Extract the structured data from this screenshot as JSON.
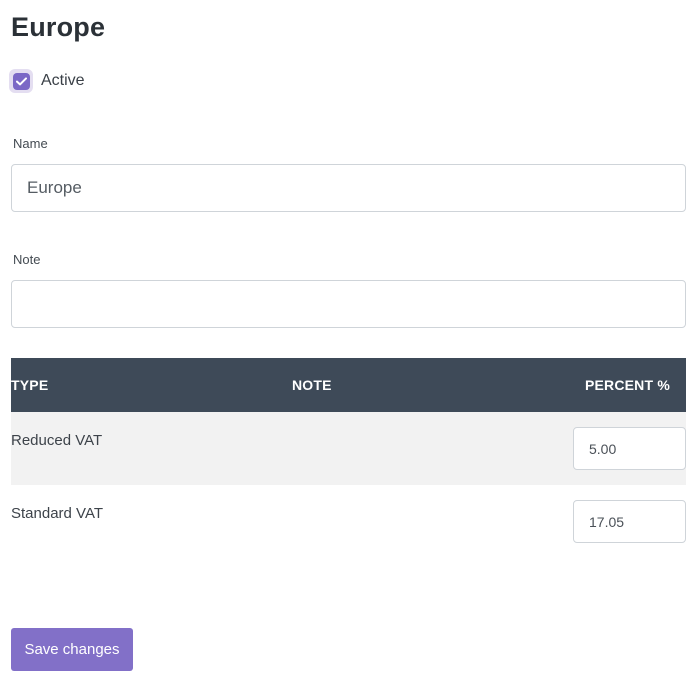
{
  "page": {
    "title": "Europe"
  },
  "active": {
    "label": "Active",
    "checked": true
  },
  "name_field": {
    "label": "Name",
    "value": "Europe"
  },
  "note_field": {
    "label": "Note",
    "value": ""
  },
  "table": {
    "headers": {
      "type": "TYPE",
      "note": "NOTE",
      "percent": "PERCENT %"
    },
    "rows": [
      {
        "type": "Reduced VAT",
        "note": "",
        "percent": "5.00"
      },
      {
        "type": "Standard VAT",
        "note": "",
        "percent": "17.05"
      }
    ]
  },
  "actions": {
    "save_label": "Save changes"
  },
  "colors": {
    "accent": "#7b68c6",
    "button": "#8270c8",
    "table_header": "#3e4a58",
    "row_shade": "#f2f2f2"
  }
}
